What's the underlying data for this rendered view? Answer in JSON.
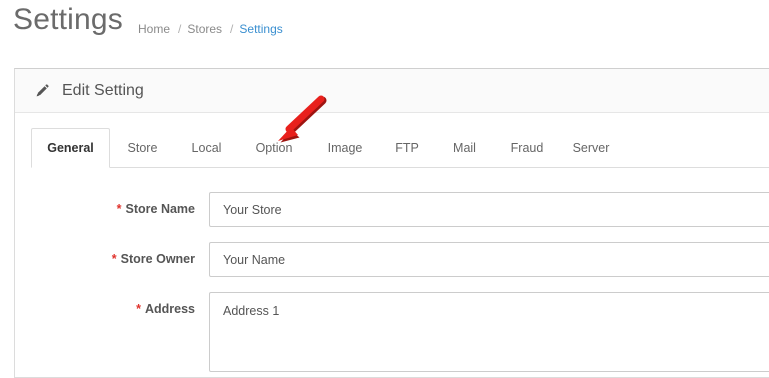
{
  "header": {
    "title": "Settings",
    "breadcrumb": [
      "Home",
      "Stores",
      "Settings"
    ],
    "breadcrumb_separator": "/"
  },
  "panel": {
    "heading_icon": "pencil-icon",
    "heading": "Edit Setting"
  },
  "tabs": [
    {
      "label": "General",
      "active": true
    },
    {
      "label": "Store",
      "active": false
    },
    {
      "label": "Local",
      "active": false
    },
    {
      "label": "Option",
      "active": false
    },
    {
      "label": "Image",
      "active": false
    },
    {
      "label": "FTP",
      "active": false
    },
    {
      "label": "Mail",
      "active": false
    },
    {
      "label": "Fraud",
      "active": false
    },
    {
      "label": "Server",
      "active": false
    }
  ],
  "form": {
    "required_marker": "*",
    "fields": [
      {
        "label": "Store Name",
        "value": "Your Store"
      },
      {
        "label": "Store Owner",
        "value": "Your Name"
      },
      {
        "label": "Address",
        "value": "Address 1"
      }
    ]
  },
  "annotation": {
    "arrow_color": "#e8201c",
    "points_to": "Option"
  },
  "colors": {
    "accent": "#3a8fd0",
    "required": "#e0322c"
  }
}
